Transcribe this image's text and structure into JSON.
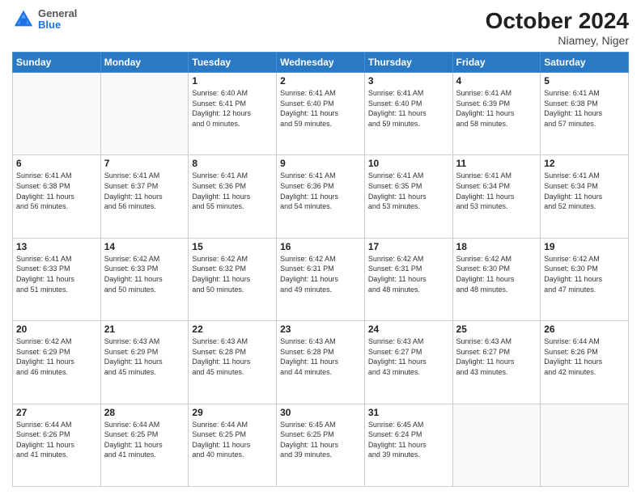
{
  "header": {
    "title": "October 2024",
    "subtitle": "Niamey, Niger",
    "logo_general": "General",
    "logo_blue": "Blue"
  },
  "days_of_week": [
    "Sunday",
    "Monday",
    "Tuesday",
    "Wednesday",
    "Thursday",
    "Friday",
    "Saturday"
  ],
  "weeks": [
    [
      {
        "day": "",
        "info": ""
      },
      {
        "day": "",
        "info": ""
      },
      {
        "day": "1",
        "info": "Sunrise: 6:40 AM\nSunset: 6:41 PM\nDaylight: 12 hours\nand 0 minutes."
      },
      {
        "day": "2",
        "info": "Sunrise: 6:41 AM\nSunset: 6:40 PM\nDaylight: 11 hours\nand 59 minutes."
      },
      {
        "day": "3",
        "info": "Sunrise: 6:41 AM\nSunset: 6:40 PM\nDaylight: 11 hours\nand 59 minutes."
      },
      {
        "day": "4",
        "info": "Sunrise: 6:41 AM\nSunset: 6:39 PM\nDaylight: 11 hours\nand 58 minutes."
      },
      {
        "day": "5",
        "info": "Sunrise: 6:41 AM\nSunset: 6:38 PM\nDaylight: 11 hours\nand 57 minutes."
      }
    ],
    [
      {
        "day": "6",
        "info": "Sunrise: 6:41 AM\nSunset: 6:38 PM\nDaylight: 11 hours\nand 56 minutes."
      },
      {
        "day": "7",
        "info": "Sunrise: 6:41 AM\nSunset: 6:37 PM\nDaylight: 11 hours\nand 56 minutes."
      },
      {
        "day": "8",
        "info": "Sunrise: 6:41 AM\nSunset: 6:36 PM\nDaylight: 11 hours\nand 55 minutes."
      },
      {
        "day": "9",
        "info": "Sunrise: 6:41 AM\nSunset: 6:36 PM\nDaylight: 11 hours\nand 54 minutes."
      },
      {
        "day": "10",
        "info": "Sunrise: 6:41 AM\nSunset: 6:35 PM\nDaylight: 11 hours\nand 53 minutes."
      },
      {
        "day": "11",
        "info": "Sunrise: 6:41 AM\nSunset: 6:34 PM\nDaylight: 11 hours\nand 53 minutes."
      },
      {
        "day": "12",
        "info": "Sunrise: 6:41 AM\nSunset: 6:34 PM\nDaylight: 11 hours\nand 52 minutes."
      }
    ],
    [
      {
        "day": "13",
        "info": "Sunrise: 6:41 AM\nSunset: 6:33 PM\nDaylight: 11 hours\nand 51 minutes."
      },
      {
        "day": "14",
        "info": "Sunrise: 6:42 AM\nSunset: 6:33 PM\nDaylight: 11 hours\nand 50 minutes."
      },
      {
        "day": "15",
        "info": "Sunrise: 6:42 AM\nSunset: 6:32 PM\nDaylight: 11 hours\nand 50 minutes."
      },
      {
        "day": "16",
        "info": "Sunrise: 6:42 AM\nSunset: 6:31 PM\nDaylight: 11 hours\nand 49 minutes."
      },
      {
        "day": "17",
        "info": "Sunrise: 6:42 AM\nSunset: 6:31 PM\nDaylight: 11 hours\nand 48 minutes."
      },
      {
        "day": "18",
        "info": "Sunrise: 6:42 AM\nSunset: 6:30 PM\nDaylight: 11 hours\nand 48 minutes."
      },
      {
        "day": "19",
        "info": "Sunrise: 6:42 AM\nSunset: 6:30 PM\nDaylight: 11 hours\nand 47 minutes."
      }
    ],
    [
      {
        "day": "20",
        "info": "Sunrise: 6:42 AM\nSunset: 6:29 PM\nDaylight: 11 hours\nand 46 minutes."
      },
      {
        "day": "21",
        "info": "Sunrise: 6:43 AM\nSunset: 6:29 PM\nDaylight: 11 hours\nand 45 minutes."
      },
      {
        "day": "22",
        "info": "Sunrise: 6:43 AM\nSunset: 6:28 PM\nDaylight: 11 hours\nand 45 minutes."
      },
      {
        "day": "23",
        "info": "Sunrise: 6:43 AM\nSunset: 6:28 PM\nDaylight: 11 hours\nand 44 minutes."
      },
      {
        "day": "24",
        "info": "Sunrise: 6:43 AM\nSunset: 6:27 PM\nDaylight: 11 hours\nand 43 minutes."
      },
      {
        "day": "25",
        "info": "Sunrise: 6:43 AM\nSunset: 6:27 PM\nDaylight: 11 hours\nand 43 minutes."
      },
      {
        "day": "26",
        "info": "Sunrise: 6:44 AM\nSunset: 6:26 PM\nDaylight: 11 hours\nand 42 minutes."
      }
    ],
    [
      {
        "day": "27",
        "info": "Sunrise: 6:44 AM\nSunset: 6:26 PM\nDaylight: 11 hours\nand 41 minutes."
      },
      {
        "day": "28",
        "info": "Sunrise: 6:44 AM\nSunset: 6:25 PM\nDaylight: 11 hours\nand 41 minutes."
      },
      {
        "day": "29",
        "info": "Sunrise: 6:44 AM\nSunset: 6:25 PM\nDaylight: 11 hours\nand 40 minutes."
      },
      {
        "day": "30",
        "info": "Sunrise: 6:45 AM\nSunset: 6:25 PM\nDaylight: 11 hours\nand 39 minutes."
      },
      {
        "day": "31",
        "info": "Sunrise: 6:45 AM\nSunset: 6:24 PM\nDaylight: 11 hours\nand 39 minutes."
      },
      {
        "day": "",
        "info": ""
      },
      {
        "day": "",
        "info": ""
      }
    ]
  ]
}
